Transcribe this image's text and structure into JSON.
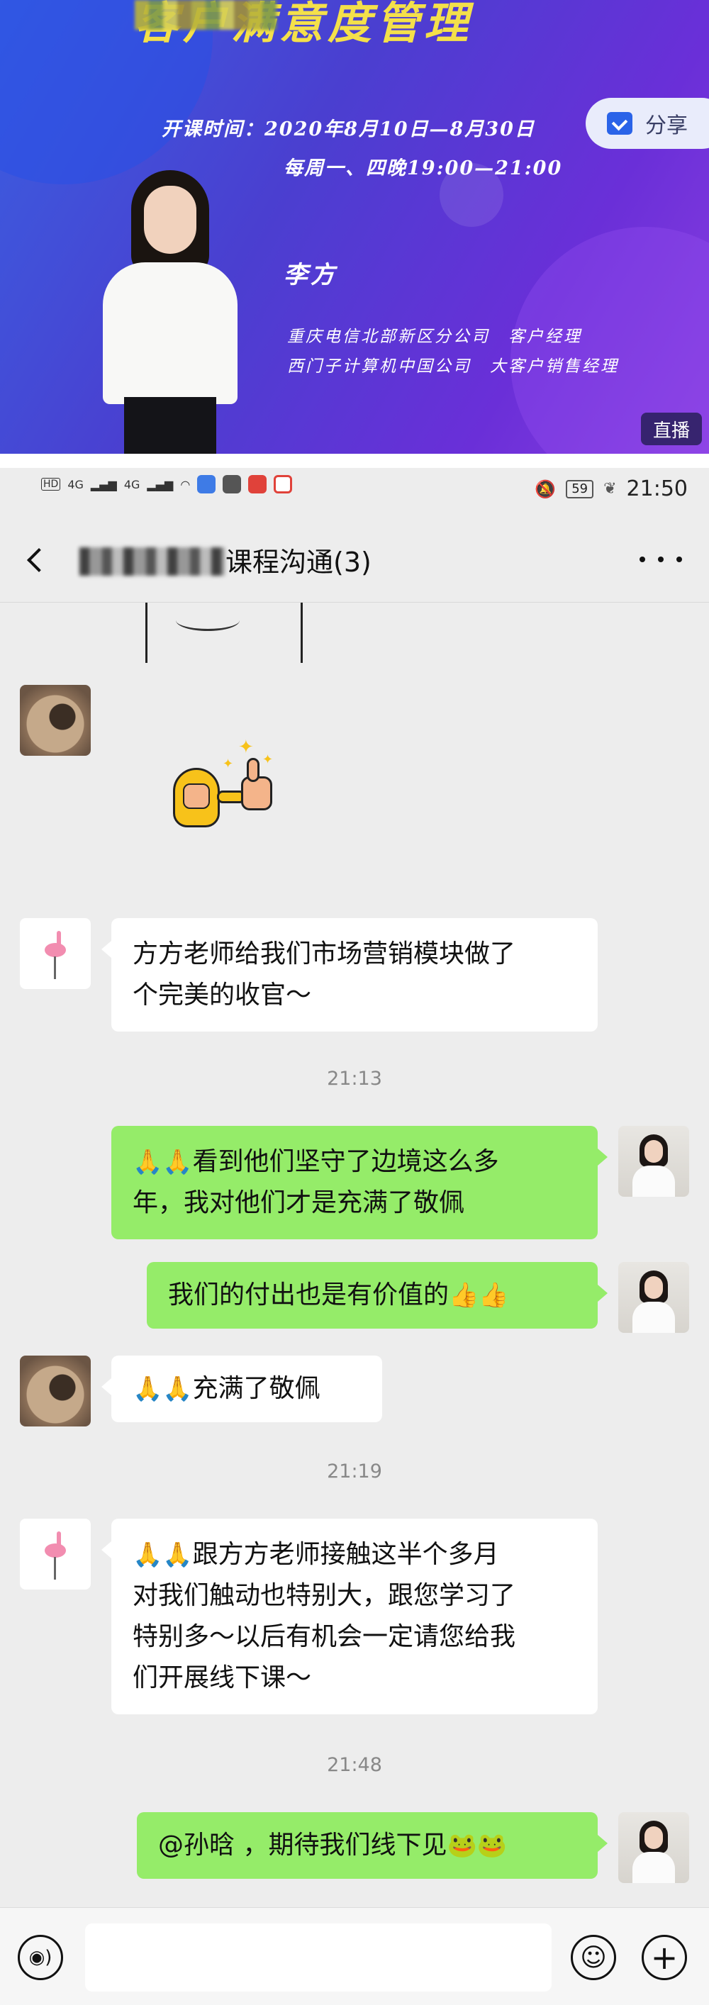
{
  "banner": {
    "title": "客户满意度管理",
    "share_label": "分享",
    "course_time": "开课时间：2020年8月10日—8月30日",
    "schedule": "每周一、四晚19:00—21:00",
    "presenter_name": "李方",
    "presenter_line1": "重庆电信北部新区分公司　客户经理",
    "presenter_line2": "西门子计算机中国公司　大客户销售经理",
    "live_label": "直播",
    "title_color": "#f4e04a"
  },
  "status_bar": {
    "network_a": "4G",
    "network_b": "4G",
    "battery": "59",
    "time": "21:50"
  },
  "header": {
    "title": "课程沟通(3)",
    "back_icon": "chevron-left-icon",
    "more_icon": "more-dots-icon"
  },
  "chat": {
    "messages": [
      {
        "side": "in",
        "avatar": "pug",
        "type": "sticker",
        "sticker": "thumbs-up-sticker"
      },
      {
        "side": "in",
        "avatar": "flamingo",
        "lines": [
          "方方老师给我们市场营销模块做了",
          "个完美的收官～"
        ]
      },
      {
        "side": "out",
        "avatar": "teacher",
        "lines": [
          "看到他们坚守了边境这么多",
          "年，我对他们才是充满了敬佩"
        ],
        "prefix_emoji": "🙏🙏"
      },
      {
        "side": "out",
        "avatar": "teacher",
        "lines": [
          "我们的付出也是有价值的"
        ],
        "suffix_emoji": "👍👍"
      },
      {
        "side": "in",
        "avatar": "pug",
        "lines": [
          "充满了敬佩"
        ],
        "prefix_emoji": "🙏🙏"
      },
      {
        "side": "in",
        "avatar": "flamingo",
        "lines": [
          "跟方方老师接触这半个多月",
          "对我们触动也特别大，跟您学习了",
          "特别多～以后有机会一定请您给我",
          "们开展线下课～"
        ],
        "prefix_emoji": "🙏🙏"
      },
      {
        "side": "out",
        "avatar": "teacher",
        "lines": [
          "@孙晗 ，期待我们线下见"
        ],
        "suffix_emoji": "🐸🐸"
      }
    ],
    "timestamps": [
      "21:13",
      "21:19",
      "21:48"
    ]
  },
  "composer": {
    "placeholder": "",
    "voice_icon": "voice-icon",
    "emoji_icon": "emoji-icon",
    "plus_icon": "plus-icon"
  },
  "colors": {
    "chat_bg": "#ededed",
    "outgoing_bubble": "#95ec69",
    "incoming_bubble": "#ffffff"
  }
}
